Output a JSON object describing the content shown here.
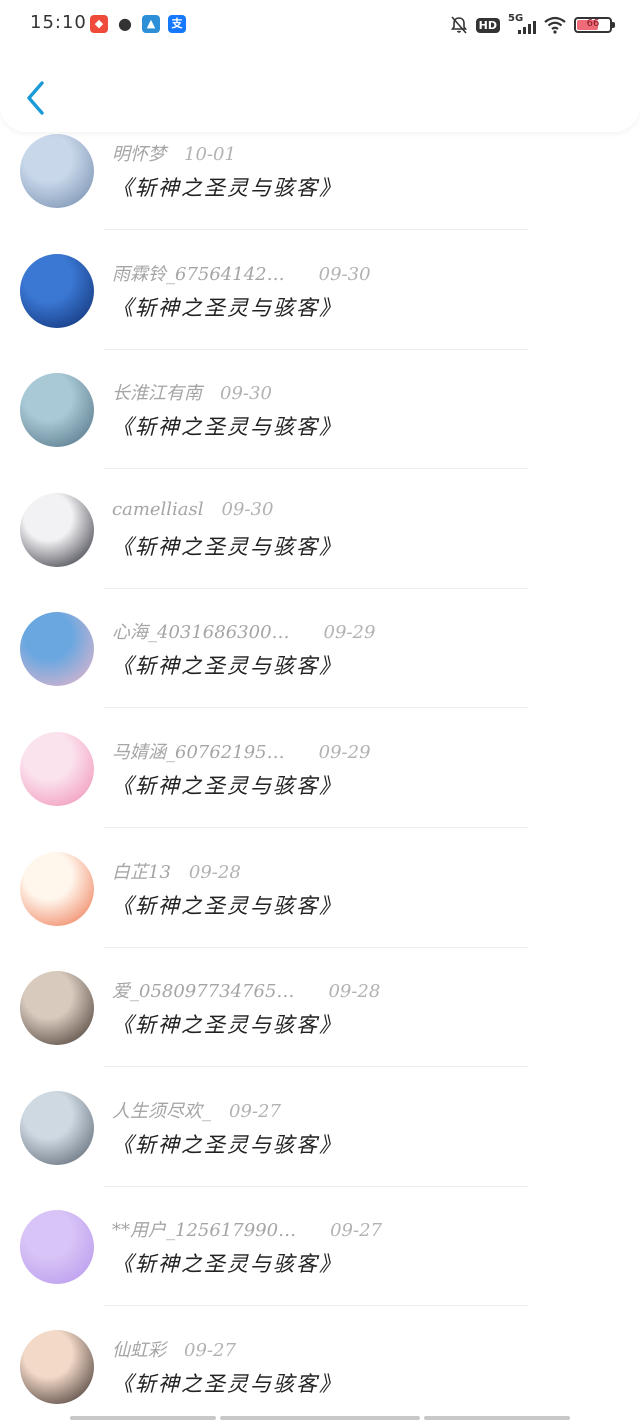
{
  "status_bar": {
    "time": "15:10",
    "hd": "HD",
    "network": "5G",
    "battery": "66",
    "battery_level": 0.66
  },
  "nav": {
    "back_icon": "chevron-left-icon",
    "accent_color": "#1a9bd7"
  },
  "comments": [
    {
      "user": "明怀梦",
      "date": "10-01",
      "text": "《斩神之圣灵与骇客》",
      "avatar_colors": [
        "#c8d8ea",
        "#6e86a8"
      ]
    },
    {
      "user": "雨霖铃_67564142…",
      "date": "09-30",
      "text": "《斩神之圣灵与骇客》",
      "avatar_colors": [
        "#3b78d4",
        "#0c2a6b"
      ]
    },
    {
      "user": "长淮江有南",
      "date": "09-30",
      "text": "《斩神之圣灵与骇客》",
      "avatar_colors": [
        "#a9c9d6",
        "#4a6b7d"
      ]
    },
    {
      "user": "camelliasl",
      "date": "09-30",
      "text": "《斩神之圣灵与骇客》",
      "avatar_colors": [
        "#f2f2f4",
        "#1d1d28"
      ]
    },
    {
      "user": "心海_4031686300…",
      "date": "09-29",
      "text": "《斩神之圣灵与骇客》",
      "avatar_colors": [
        "#6aa7e0",
        "#f0b7c9"
      ]
    },
    {
      "user": "马婧涵_60762195…",
      "date": "09-29",
      "text": "《斩神之圣灵与骇客》",
      "avatar_colors": [
        "#fbe3ee",
        "#ef8ab2"
      ]
    },
    {
      "user": "白芷13",
      "date": "09-28",
      "text": "《斩神之圣灵与骇客》",
      "avatar_colors": [
        "#fff6ec",
        "#ec6f47"
      ]
    },
    {
      "user": "爱_058097734765…",
      "date": "09-28",
      "text": "《斩神之圣灵与骇客》",
      "avatar_colors": [
        "#d8cabd",
        "#3a2d26"
      ]
    },
    {
      "user": "人生须尽欢_",
      "date": "09-27",
      "text": "《斩神之圣灵与骇客》",
      "avatar_colors": [
        "#cfd9e2",
        "#4e5a66"
      ]
    },
    {
      "user": "**用户_125617990…",
      "date": "09-27",
      "text": "《斩神之圣灵与骇客》",
      "avatar_colors": [
        "#d8c4f6",
        "#b595ec"
      ]
    },
    {
      "user": "仙虹彩",
      "date": "09-27",
      "text": "《斩神之圣灵与骇客》",
      "avatar_colors": [
        "#f3d9c8",
        "#2d2320"
      ]
    }
  ]
}
